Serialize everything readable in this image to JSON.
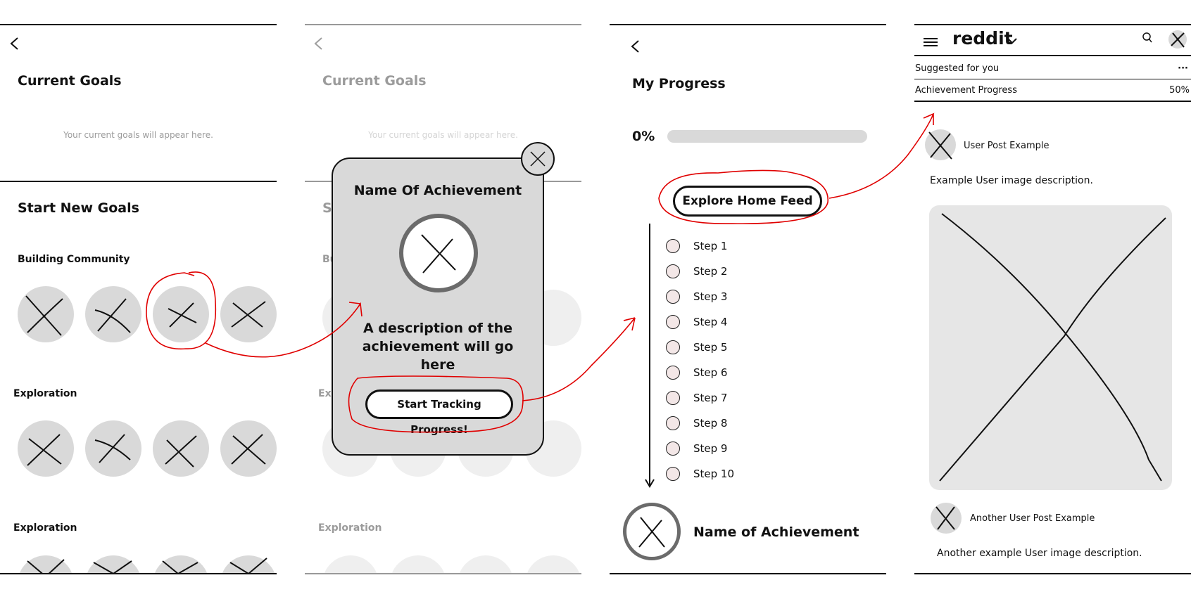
{
  "screen1": {
    "header": {
      "title": "Current Goals",
      "empty_text": "Your current goals will appear here."
    },
    "section_title": "Start New Goals",
    "categories": [
      "Building Community",
      "Exploration",
      "Exploration"
    ]
  },
  "screen2": {
    "background": {
      "title": "Current Goals",
      "empty_text": "Your current goals will appear here.",
      "section_title_partial": "St",
      "category_partial_1": "Bu",
      "category_partial_2": "Exp",
      "category_3": "Exploration"
    },
    "modal": {
      "title": "Name Of Achievement",
      "description": "A description of the achievement will go here",
      "button_label": "Start Tracking Progress!"
    }
  },
  "screen3": {
    "title": "My Progress",
    "progress": {
      "label": "0%",
      "value": 0
    },
    "explore_button": "Explore Home Feed",
    "steps": [
      "Step 1",
      "Step 2",
      "Step 3",
      "Step 4",
      "Step 5",
      "Step 6",
      "Step 7",
      "Step 8",
      "Step 9",
      "Step 10"
    ],
    "achievement_name": "Name of Achievement"
  },
  "screen4": {
    "app_name": "reddit",
    "rows": [
      {
        "label": "Suggested for you",
        "value": "···"
      },
      {
        "label": "Achievement Progress",
        "value": "50%"
      }
    ],
    "posts": [
      {
        "user": "User Post Example",
        "description": "Example User image description."
      },
      {
        "user": "Another User Post Example",
        "description": "Another example User image description."
      }
    ]
  },
  "colors": {
    "annotation": "#e00000",
    "placeholder": "#d9d9d9",
    "text": "#111111"
  }
}
